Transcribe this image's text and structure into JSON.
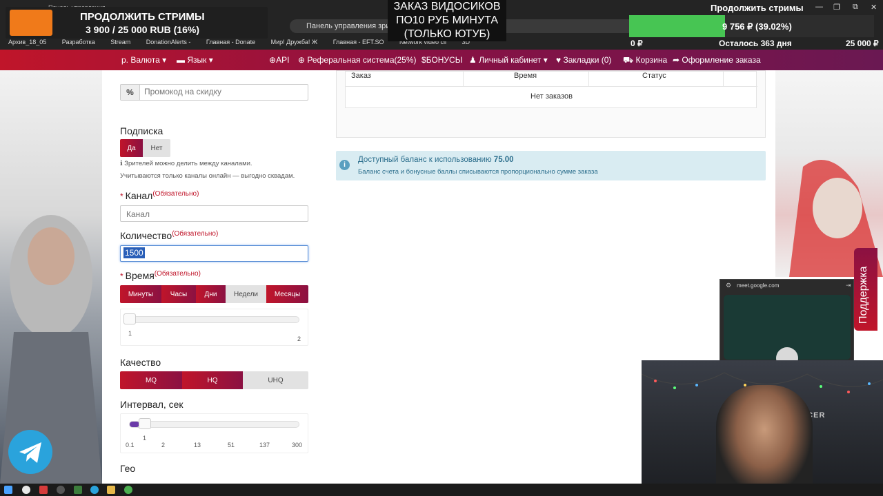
{
  "browser": {
    "tab_title": "Панель управления",
    "address_text": "Панель управления зрит",
    "bookmarks": [
      "Архив_18_05",
      "Разработка",
      "Stream",
      "DonationAlerts -",
      "Главная - Donate",
      "Мир! Дружба! Ж",
      "Главная - EFT.SO",
      "Network video cli",
      "3D"
    ]
  },
  "overlays": {
    "left_goal": {
      "title": "ПРОДОЛЖИТЬ СТРИМЫ",
      "amount": "3 900 / 25 000 RUB (16%)",
      "progress": 0.16
    },
    "order_banner": {
      "line1": "ЗАКАЗ ВИДОСИКОВ",
      "line2": "ПО10 РУБ МИНУТА",
      "line3": "(ТОЛЬКО ЮТУБ)"
    },
    "right_goal": {
      "title": "Продолжить стримы",
      "progress_text": "9 756 ₽ (39.02%)",
      "progress": 0.3902,
      "start": "0 ₽",
      "remaining": "Осталось 363 дня",
      "end": "25 000 ₽"
    }
  },
  "nav": {
    "currency": "Валюта",
    "language": "Язык",
    "api": "API",
    "referral": "Реферальная система(25%)",
    "bonus": "БОНУСЫ",
    "cabinet": "Личный кабинет",
    "bookmarks": "Закладки (0)",
    "cart": "Корзина",
    "checkout": "Оформление заказа"
  },
  "form": {
    "promo_placeholder": "Промокод на скидку",
    "promo_prefix": "%",
    "subscription_label": "Подписка",
    "subscription_yes": "Да",
    "subscription_no": "Нет",
    "hint1": "Зрителей можно делить между каналами.",
    "hint2": "Учитываются только каналы онлайн — выгодно сквадам.",
    "required_note": "(Обязательно)",
    "channel_label": "Канал",
    "channel_placeholder": "Канал",
    "quantity_label": "Количество",
    "quantity_value": "1500",
    "time_label": "Время",
    "time_units": [
      "Минуты",
      "Часы",
      "Дни",
      "Недели",
      "Месяцы"
    ],
    "time_slider": {
      "value": "1",
      "min": "1",
      "max": "2"
    },
    "quality_label": "Качество",
    "quality_options": [
      "MQ",
      "HQ",
      "UHQ"
    ],
    "interval_label": "Интервал, сек",
    "interval_slider": {
      "value": "1",
      "ticks": [
        "0.1",
        "2",
        "13",
        "51",
        "137",
        "300"
      ]
    },
    "geo_label": "Гео"
  },
  "orders": {
    "columns": [
      "Заказ",
      "Время",
      "Статус"
    ],
    "empty_text": "Нет заказов"
  },
  "balance": {
    "main_text": "Доступный баланс к использованию",
    "amount": "75.00",
    "sub_text": "Баланс счета и бонусные баллы списываются пропорционально сумме заказа"
  },
  "support": {
    "label": "Поддержка"
  },
  "meet": {
    "url": "meet.google.com"
  },
  "webcam": {
    "chair_brand": "DXRACER"
  },
  "colors": {
    "brand_red": "#c0152a",
    "brand_purple": "#6a1852",
    "goal_green": "#47c553",
    "info_bg": "#d9ecf2"
  }
}
